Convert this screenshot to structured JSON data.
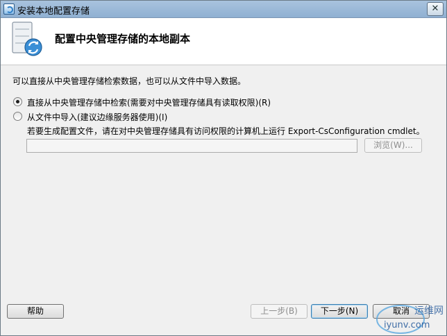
{
  "window": {
    "title": "安装本地配置存储"
  },
  "header": {
    "title": "配置中央管理存储的本地副本"
  },
  "description": "可以直接从中央管理存储检索数据，也可以从文件中导入数据。",
  "options": [
    {
      "label": "直接从中央管理存储中检索(需要对中央管理存储具有读取权限)(R)",
      "selected": true
    },
    {
      "label": "从文件中导入(建议边缘服务器使用)(I)",
      "selected": false
    }
  ],
  "import_hint": "若要生成配置文件，请在对中央管理存储具有访问权限的计算机上运行 Export-CsConfiguration cmdlet。",
  "file_path": {
    "value": "",
    "browse_label": "浏览(W)..."
  },
  "footer": {
    "help_label": "帮助",
    "back_label": "上一步(B)",
    "next_label": "下一步(N)",
    "cancel_label": "取消"
  },
  "watermark": {
    "site": "iyunv.com",
    "brand": "运维网"
  },
  "colors": {
    "accent": "#2f7fc7",
    "titlebar": "#9dbad8"
  }
}
